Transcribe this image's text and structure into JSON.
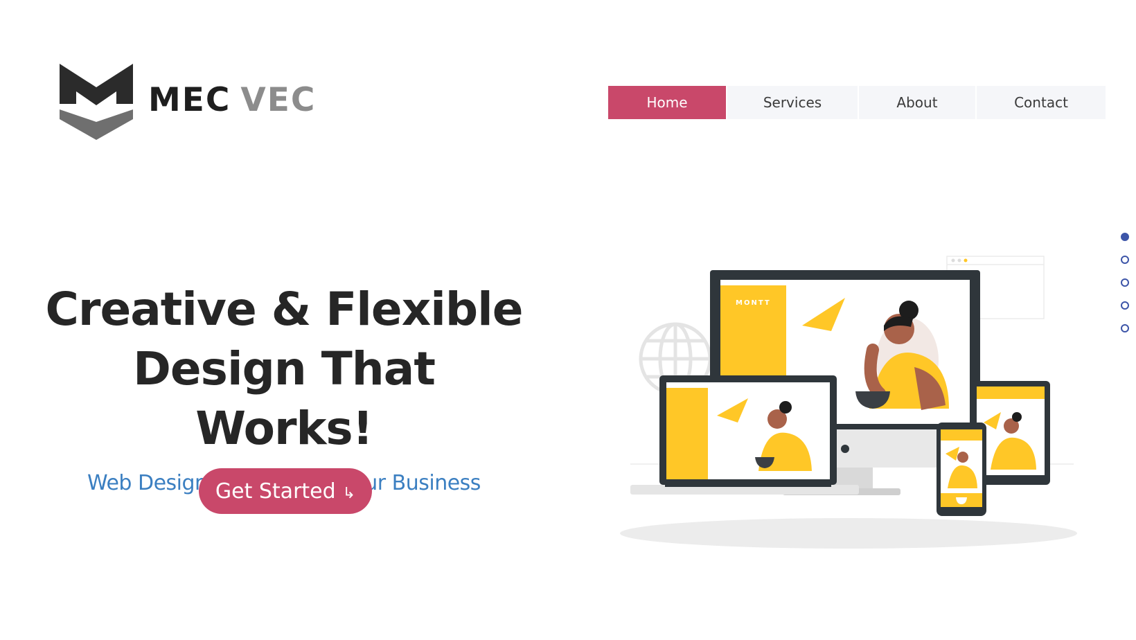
{
  "brand": {
    "name_part1": "MEC",
    "name_part2": "VEC"
  },
  "nav": {
    "items": [
      {
        "label": "Home",
        "active": true
      },
      {
        "label": "Services",
        "active": false
      },
      {
        "label": "About",
        "active": false
      },
      {
        "label": "Contact",
        "active": false
      }
    ]
  },
  "hero": {
    "title_line1": "Creative & Flexible",
    "title_line2": "Design That Works!",
    "subtitle": "Web Design Services For Your Business",
    "cta_label": "Get Started",
    "cta_icon": "arrow-down-right-icon"
  },
  "slider": {
    "count": 5,
    "active_index": 0
  },
  "illustration": {
    "brand_on_screen": "MONTT"
  },
  "colors": {
    "accent": "#c9486a",
    "subtitle": "#3b7fc1",
    "dot": "#3d55a8",
    "device_dark": "#2f363b",
    "illustration_yellow": "#ffc727",
    "skin": "#a9624a"
  }
}
